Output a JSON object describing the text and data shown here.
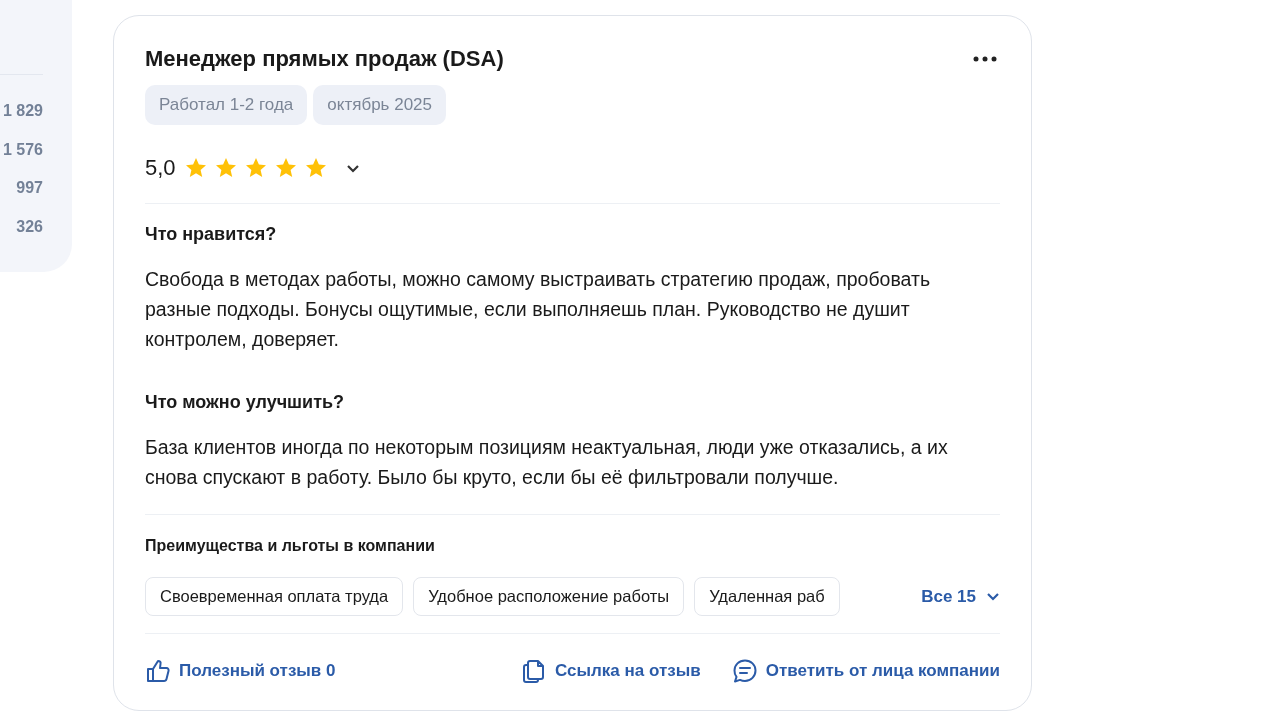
{
  "side_counts": [
    "1 829",
    "1 576",
    "997",
    "326"
  ],
  "review": {
    "title": "Менеджер прямых продаж (DSA)",
    "tags": [
      "Работал 1-2 года",
      "октябрь 2025"
    ],
    "rating": "5,0",
    "stars": 5,
    "sections": [
      {
        "heading": "Что нравится?",
        "text": "Свобода в методах работы, можно самому выстраивать стратегию продаж, пробовать разные подходы. Бонусы ощутимые, если выполняешь план. Руководство не душит контролем, доверяет."
      },
      {
        "heading": "Что можно улучшить?",
        "text": "База клиентов иногда по некоторым позициям неактуальная, люди уже отказались, а их снова спускают в работу. Было бы круто, если бы её фильтровали получше."
      }
    ],
    "benefits_title": "Преимущества и льготы в компании",
    "benefits": [
      "Своевременная оплата труда",
      "Удобное расположение работы",
      "Удаленная раб"
    ],
    "benefits_more": "Все 15",
    "actions": [
      {
        "kind": "like",
        "label": "Полезный отзыв 0"
      },
      {
        "kind": "link",
        "label": "Ссылка на отзыв"
      },
      {
        "kind": "reply",
        "label": "Ответить от лица компании"
      }
    ]
  }
}
